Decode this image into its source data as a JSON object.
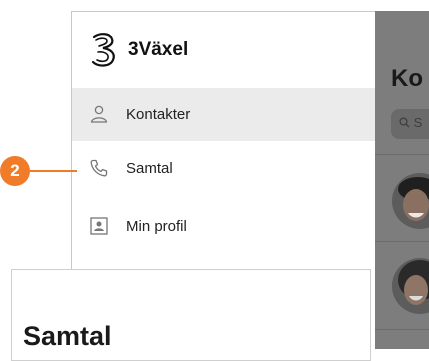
{
  "app": {
    "name": "3Växel"
  },
  "sidebar": {
    "items": [
      {
        "label": "Kontakter",
        "icon": "person-icon",
        "active": true
      },
      {
        "label": "Samtal",
        "icon": "phone-icon",
        "active": false
      },
      {
        "label": "Min profil",
        "icon": "profile-card-icon",
        "active": false
      }
    ]
  },
  "content": {
    "title": "Ko",
    "search_placeholder": "S"
  },
  "callout": {
    "number": "2",
    "color": "#f07c2a"
  },
  "popup": {
    "title": "Samtal"
  },
  "colors": {
    "accent": "#f07c2a",
    "overlay": "#7d7d7d",
    "active_row": "#ebebeb"
  }
}
